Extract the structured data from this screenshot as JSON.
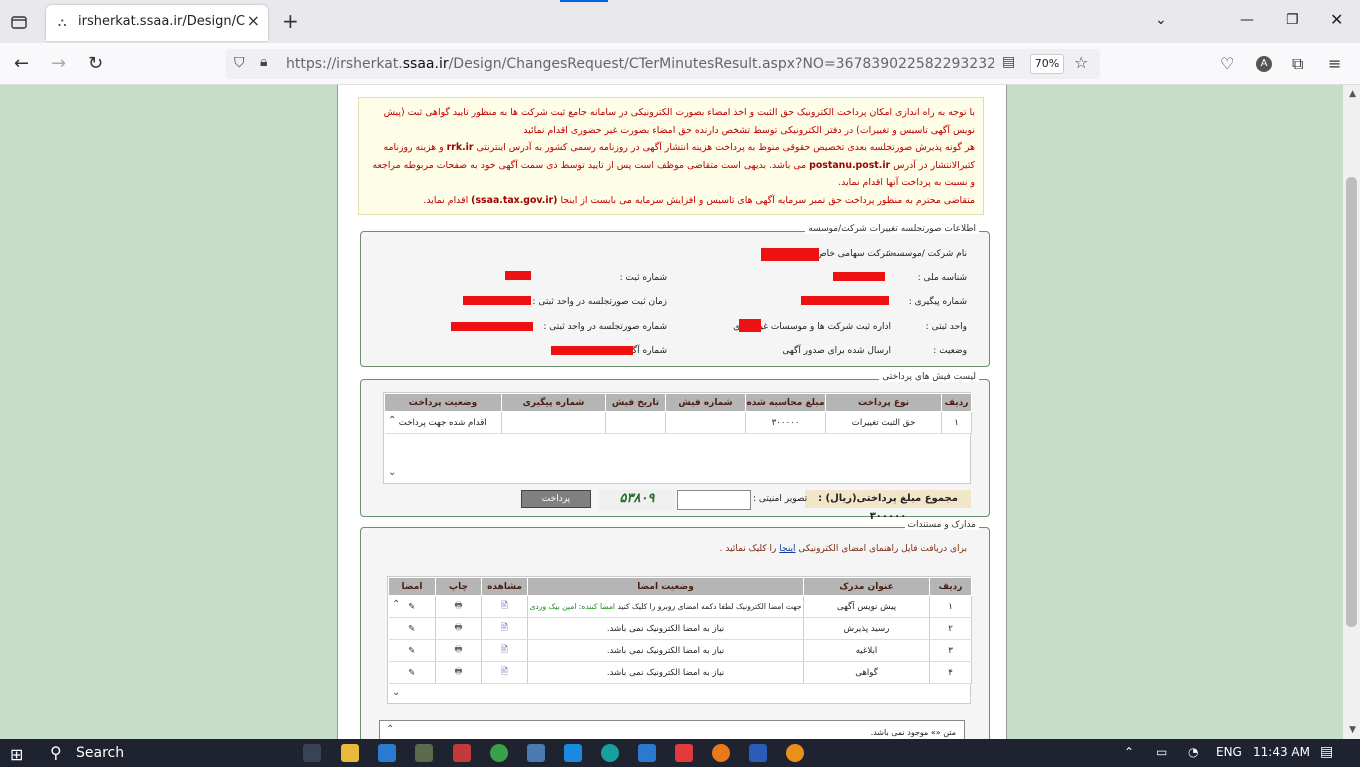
{
  "browser": {
    "tab_title": "irsherkat.ssaa.ir/Design/Change",
    "url_prefix": "https://irsherkat.",
    "url_domain": "ssaa.ir",
    "url_rest": "/Design/ChangesRequest/CTerMinutesResult.aspx?NO=3678390225822932324&NC=1401",
    "zoom": "70%"
  },
  "notice": {
    "line1": "با توجه به راه اندازی امکان پرداخت الکترونیک حق الثبت و اخذ امضاء بصورت الکترونیکی در سامانه جامع ثبت شرکت ها به منظور تایید گواهی ثبت (پیش نویس آگهی تاسیس و تغییرات) در دفتر الکترونیکی توسط تشخص دارنده حق امضاء بصورت غیر حضوری اقدام نمائید",
    "line2a": "هر گونه پذیرش صورتجلسه بعدی تخصیص حقوقی منوط به پرداخت هزینه انتشار آگهی در روزنامه رسمی کشور به آدرس اینترنتی",
    "rrk": "rrk.ir",
    "line2b": "و هزینه روزنامه کثیرالانتشار در آدرس",
    "postanu": "postanu.post.ir",
    "line2c": "می باشد. بدیهی است متقاضی موظف است پس از تایید توسط ذی سمت آگهی خود به صفحات مربوطه مراجعه و نسبت به پرداخت آنها اقدام نماید.",
    "line3a": "متقاضی محترم به منظور پرداخت حق تمبر سرمایه آگهی های تاسیس و افزایش سرمایه می بایست از اینجا",
    "tax": "(ssaa.tax.gov.ir)",
    "line3b": "اقدام نماید."
  },
  "info": {
    "legend": "اطلاعات صورتجلسه تغییرات شرکت/موسسه",
    "company_name_label": "نام شرکت /موسسه :",
    "company_name_value": "شرکت سهامی خاص",
    "national_id_label": "شناسه ملی :",
    "reg_no_label": "شماره ثبت :",
    "tracking_label": "شماره پیگیری :",
    "minutes_time_label": "زمان ثبت صورتجلسه در واحد ثبتی :",
    "reg_unit_label": "واحد ثبتی :",
    "reg_unit_value": "اداره ثبت شرکت ها و موسسات غیرتجاری",
    "minutes_no_label": "شماره صورتجلسه در واحد ثبتی :",
    "status_label": "وضعیت :",
    "status_value": "ارسال شده برای صدور آگهی",
    "ad_no_label": "شماره آگهی:"
  },
  "payments": {
    "legend": "لیست فیش های پرداختی",
    "headers": [
      "ردیف",
      "نوع پرداخت",
      "مبلغ محاسبه شده",
      "شماره فیش",
      "تاریخ فیش",
      "شماره پیگیری",
      "وضعیت پرداخت"
    ],
    "rows": [
      [
        "۱",
        "حق الثبت تغییرات",
        "۳۰۰۰۰۰",
        "",
        "",
        "",
        "اقدام شده جهت پرداخت"
      ]
    ],
    "total_label": "مجموع مبلغ پرداختی(ریال) : ۳۰۰۰۰۰",
    "captcha_label": "تصویر امنیتی :",
    "captcha_text": "۵۳۸۰۹",
    "pay_button": "پرداخت"
  },
  "docs": {
    "legend": "مدارک و مستندات",
    "guide_a": "برای دریافت فایل راهنمای امضای الکترونیکی",
    "guide_link": "اینجا",
    "guide_b": "را کلیک نمائید .",
    "headers": [
      "ردیف",
      "عنوان مدرک",
      "وضعیت امضا",
      "مشاهده",
      "چاپ",
      "امضا"
    ],
    "rows": [
      {
        "no": "۱",
        "title": "پیش نویس آگهی",
        "status": "جهت امضا الکترونیک لطفا دکمه امضای روبرو را کلیک کنید",
        "extra": "امضا کننده: امین بیک وردی"
      },
      {
        "no": "۲",
        "title": "رسید پذیرش",
        "status": "نیاز به امضا الکترونیک نمی باشد.",
        "extra": ""
      },
      {
        "no": "۳",
        "title": "ابلاغیه",
        "status": "نیاز به امضا الکترونیک نمی باشد.",
        "extra": ""
      },
      {
        "no": "۴",
        "title": "گواهی",
        "status": "نیاز به امضا الکترونیک نمی باشد.",
        "extra": ""
      }
    ],
    "text_box": "متن «» موجود نمی باشد."
  },
  "taskbar": {
    "search": "Search",
    "lang": "ENG",
    "time": "11:43 AM"
  }
}
